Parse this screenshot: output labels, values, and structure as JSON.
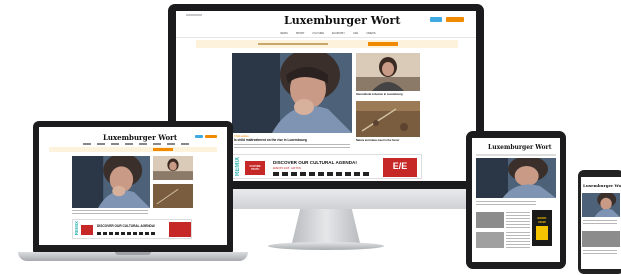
{
  "site": {
    "logo": "Luxemburger Wort",
    "nav": [
      "NEWS",
      "SPORT",
      "CULTURE",
      "ECONOMY",
      "LIFE",
      "VIDEOS"
    ],
    "lead_headline": "Is child maltreatment on the rise in Luxembourg",
    "lead_kicker": "Child welfare",
    "side_headline_1": "Intercultural cohesion in Luxembourg",
    "side_headline_2": "Nature and ideas meet in the forest",
    "remix_label": "REMIX",
    "ad_tag": "CULTURE YOUTH",
    "ad_headline": "DISCOVER OUR CULTURAL AGENDA!",
    "ad_sub": "EMEXPO 2025 · EDITION",
    "ad_mark": "E/E",
    "tablet_ad_text": "BOOK NOW"
  },
  "colors": {
    "accent_orange": "#f08a00",
    "accent_blue": "#3fa9e0",
    "banner_bg": "#fdf3dc",
    "ad_red": "#c62828",
    "ad_teal": "#32b5b0"
  },
  "icons": {
    "photo": "girl-thinking-photo",
    "woman_photo": "woman-portrait-photo",
    "forest_photo": "forest-ground-photo"
  }
}
